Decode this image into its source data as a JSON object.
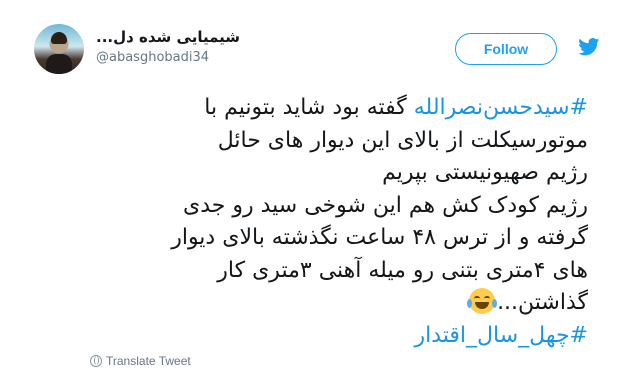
{
  "user": {
    "display_name": "شیمیایی شده دل...",
    "handle": "@abasghobadi34"
  },
  "follow_label": "Follow",
  "tweet": {
    "lines": [
      {
        "hashtag": "#سیدحسن‌نصرالله",
        "text": " گفته بود شاید بتونیم با"
      },
      {
        "text": "موتورسیکلت از بالای این دیوار های حائل"
      },
      {
        "text": "رژیم صهیونیستی بپریم"
      },
      {
        "text": "رژیم کودک کش هم این شوخی سید رو جدی"
      },
      {
        "text": "گرفته و از ترس ۴۸ ساعت نگذشته بالای دیوار"
      },
      {
        "text": "های ۴متری بتنی رو میله آهنی ۳متری کار"
      },
      {
        "text": "گذاشتن..."
      }
    ],
    "closing_hashtag": "#چهل_سال_اقتدار",
    "emoji": "face-with-tears-of-joy"
  },
  "translate_label": "Translate Tweet",
  "colors": {
    "accent": "#1da1f2",
    "link": "#1b95e0",
    "text": "#14171a",
    "muted": "#657786"
  }
}
